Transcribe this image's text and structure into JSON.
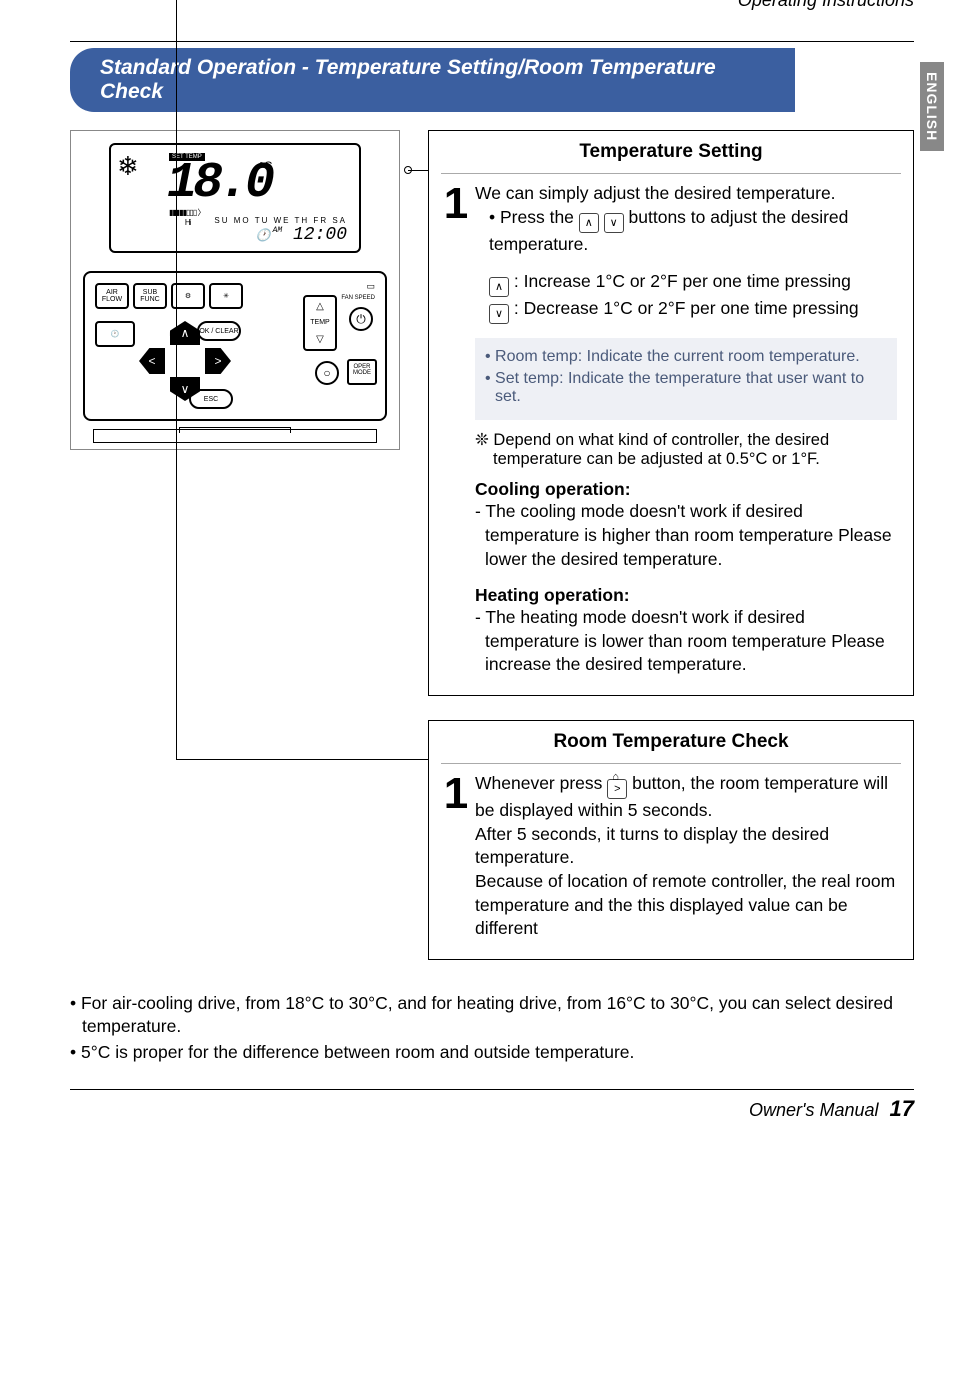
{
  "header": {
    "running_head": "Operating Instructions",
    "side_tab": "ENGLISH"
  },
  "title": "Standard Operation - Temperature Setting/Room Temperature Check",
  "diagram": {
    "set_temp_label": "SET TEMP",
    "temp_value": "18.0",
    "unit": "°C",
    "time_label": "AM",
    "time_value": "12:00",
    "weekday_row": "SU MO TU WE TH FR SA",
    "buttons": {
      "air_flow": "AIR FLOW",
      "sub_func": "SUB FUNC",
      "gear": "⚙",
      "vent": "VENT",
      "fan_speed": "FAN SPEED",
      "ok_clear": "OK / CLEAR",
      "temp": "TEMP",
      "oper_mode": "OPER MODE",
      "esc": "ESC"
    }
  },
  "box1": {
    "title": "Temperature Setting",
    "step_num": "1",
    "p1": "We can simply adjust the desired temperature.",
    "p2a": "• Press the ",
    "p2b": " buttons to adjust the desired temperature.",
    "inc": ": Increase 1°C or 2°F per one time pressing",
    "dec": ": Decrease 1°C or 2°F per one time pressing",
    "note1": "• Room temp: Indicate the current room temperature.",
    "note2": "• Set temp: Indicate the temperature that user want to set.",
    "star": "❊ Depend on what kind of controller, the desired temperature can be adjusted at 0.5°C or 1°F.",
    "cooling_head": "Cooling operation:",
    "cooling_body": "- The cooling mode doesn't work if desired temperature is higher than room temperature Please lower the desired temperature.",
    "heating_head": "Heating operation:",
    "heating_body": "- The heating mode doesn't work if desired temperature is lower than room temperature Please increase the desired temperature."
  },
  "box2": {
    "title": "Room Temperature Check",
    "step_num": "1",
    "p1a": "Whenever press ",
    "p1b": " button, the room temperature will be displayed within 5 seconds.",
    "p2": "After 5 seconds, it turns to display the desired temperature.",
    "p3": "Because of location of remote controller, the real room temperature and the this displayed value can be different"
  },
  "footer_notes": {
    "n1": "• For air-cooling drive, from 18°C to 30°C, and for heating drive, from 16°C to 30°C, you can select desired temperature.",
    "n2": "• 5°C is proper for the difference between room and outside temperature."
  },
  "page_footer": {
    "label": "Owner's Manual",
    "page": "17"
  }
}
